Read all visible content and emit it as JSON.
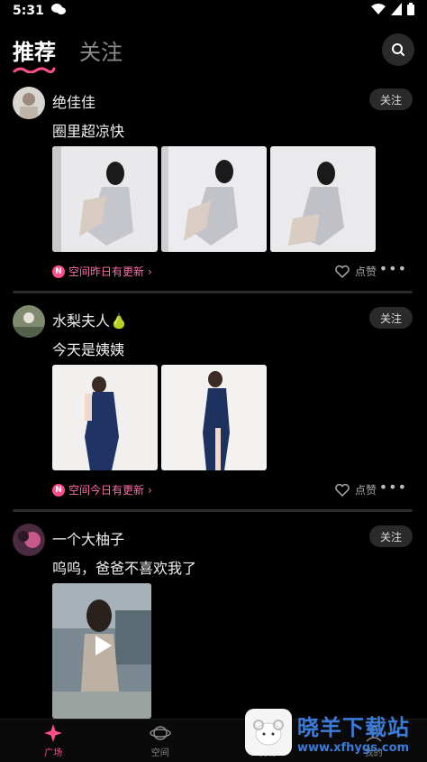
{
  "status": {
    "time": "5:31"
  },
  "nav": {
    "tab_recommend": "推荐",
    "tab_follow": "关注"
  },
  "posts": [
    {
      "username": "绝佳佳",
      "follow": "关注",
      "caption": "圈里超凉快",
      "space_update": "空间昨日有更新",
      "like": "点赞"
    },
    {
      "username": "水梨夫人🍐",
      "follow": "关注",
      "caption": "今天是姨姨",
      "space_update": "空间今日有更新",
      "like": "点赞"
    },
    {
      "username": "一个大柚子",
      "follow": "关注",
      "caption": "呜呜，爸爸不喜欢我了"
    }
  ],
  "bottom_nav": {
    "square": "广场",
    "space": "空间",
    "discover": "发现",
    "mine": "我的"
  },
  "watermark": {
    "title": "晓羊下载站",
    "url": "www.xfhygs.com"
  },
  "colors": {
    "accent": "#ff4f8b",
    "background": "#000000"
  }
}
